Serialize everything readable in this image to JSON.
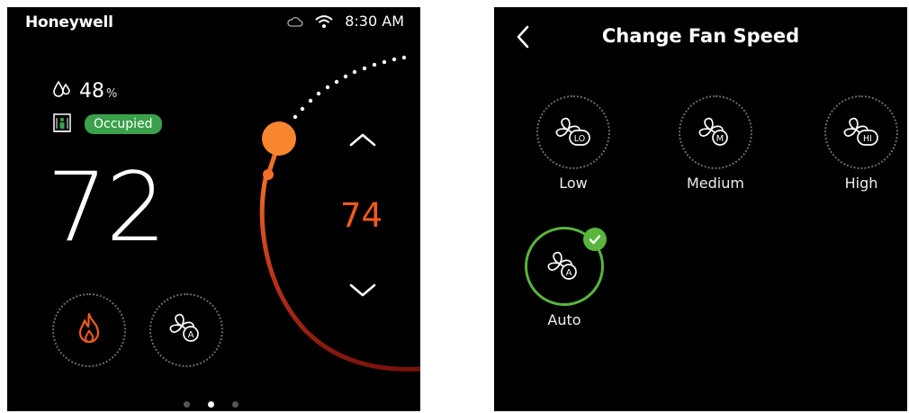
{
  "thermostat": {
    "brand": "Honeywell",
    "time": "8:30 AM",
    "icons": {
      "cloud": "cloud-icon",
      "wifi": "wifi-icon",
      "humidity": "humidity-icon",
      "occupancy": "building-person-icon"
    },
    "humidity_value": "48",
    "humidity_unit": "%",
    "occupancy_status": "Occupied",
    "current_temperature": "72",
    "setpoint": "74",
    "mode_buttons": [
      {
        "name": "heat",
        "icon": "flame-icon"
      },
      {
        "name": "fan-auto",
        "icon": "fan-auto-icon",
        "badge": "A"
      }
    ],
    "page_indicator": {
      "count": 3,
      "active_index": 1
    },
    "colors": {
      "accent": "#f05a1e",
      "occupied": "#3aa14a",
      "background": "#000000"
    }
  },
  "fan_speed": {
    "title": "Change Fan Speed",
    "back_icon": "chevron-left-icon",
    "options": [
      {
        "label": "Low",
        "badge": "LO",
        "selected": false
      },
      {
        "label": "Medium",
        "badge": "M",
        "selected": false
      },
      {
        "label": "High",
        "badge": "HI",
        "selected": false
      },
      {
        "label": "Auto",
        "badge": "A",
        "selected": true
      }
    ],
    "colors": {
      "selected": "#59b53e"
    }
  }
}
